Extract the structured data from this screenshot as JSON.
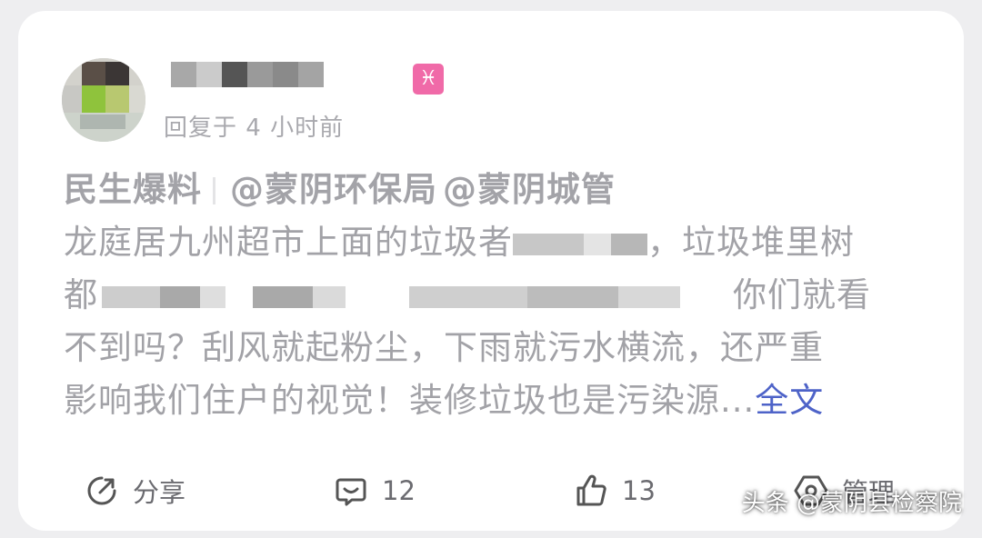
{
  "comment": {
    "zodiac_badge": "♓",
    "meta": "回复于 4 小时前",
    "topic": "民生爆料",
    "mentions": [
      "@蒙阴环保局",
      "@蒙阴城管"
    ],
    "text_lines": [
      "龙庭居九州超市上面的垃圾者",
      "，垃圾堆里树",
      "都",
      "你们就看",
      "不到吗？刮风就起粉尘，下雨就污水横流，还严重",
      "影响我们住户的视觉！装修垃圾也是污染源..."
    ],
    "full_text_link": "全文"
  },
  "actions": {
    "share_label": "分享",
    "comment_count": "12",
    "like_count": "13",
    "manage_label": "管理"
  },
  "watermark": "头条 @蒙阴县检察院",
  "colors": {
    "link": "#4e63c8",
    "badge": "#f06aa8",
    "text": "#a2a2a7"
  }
}
